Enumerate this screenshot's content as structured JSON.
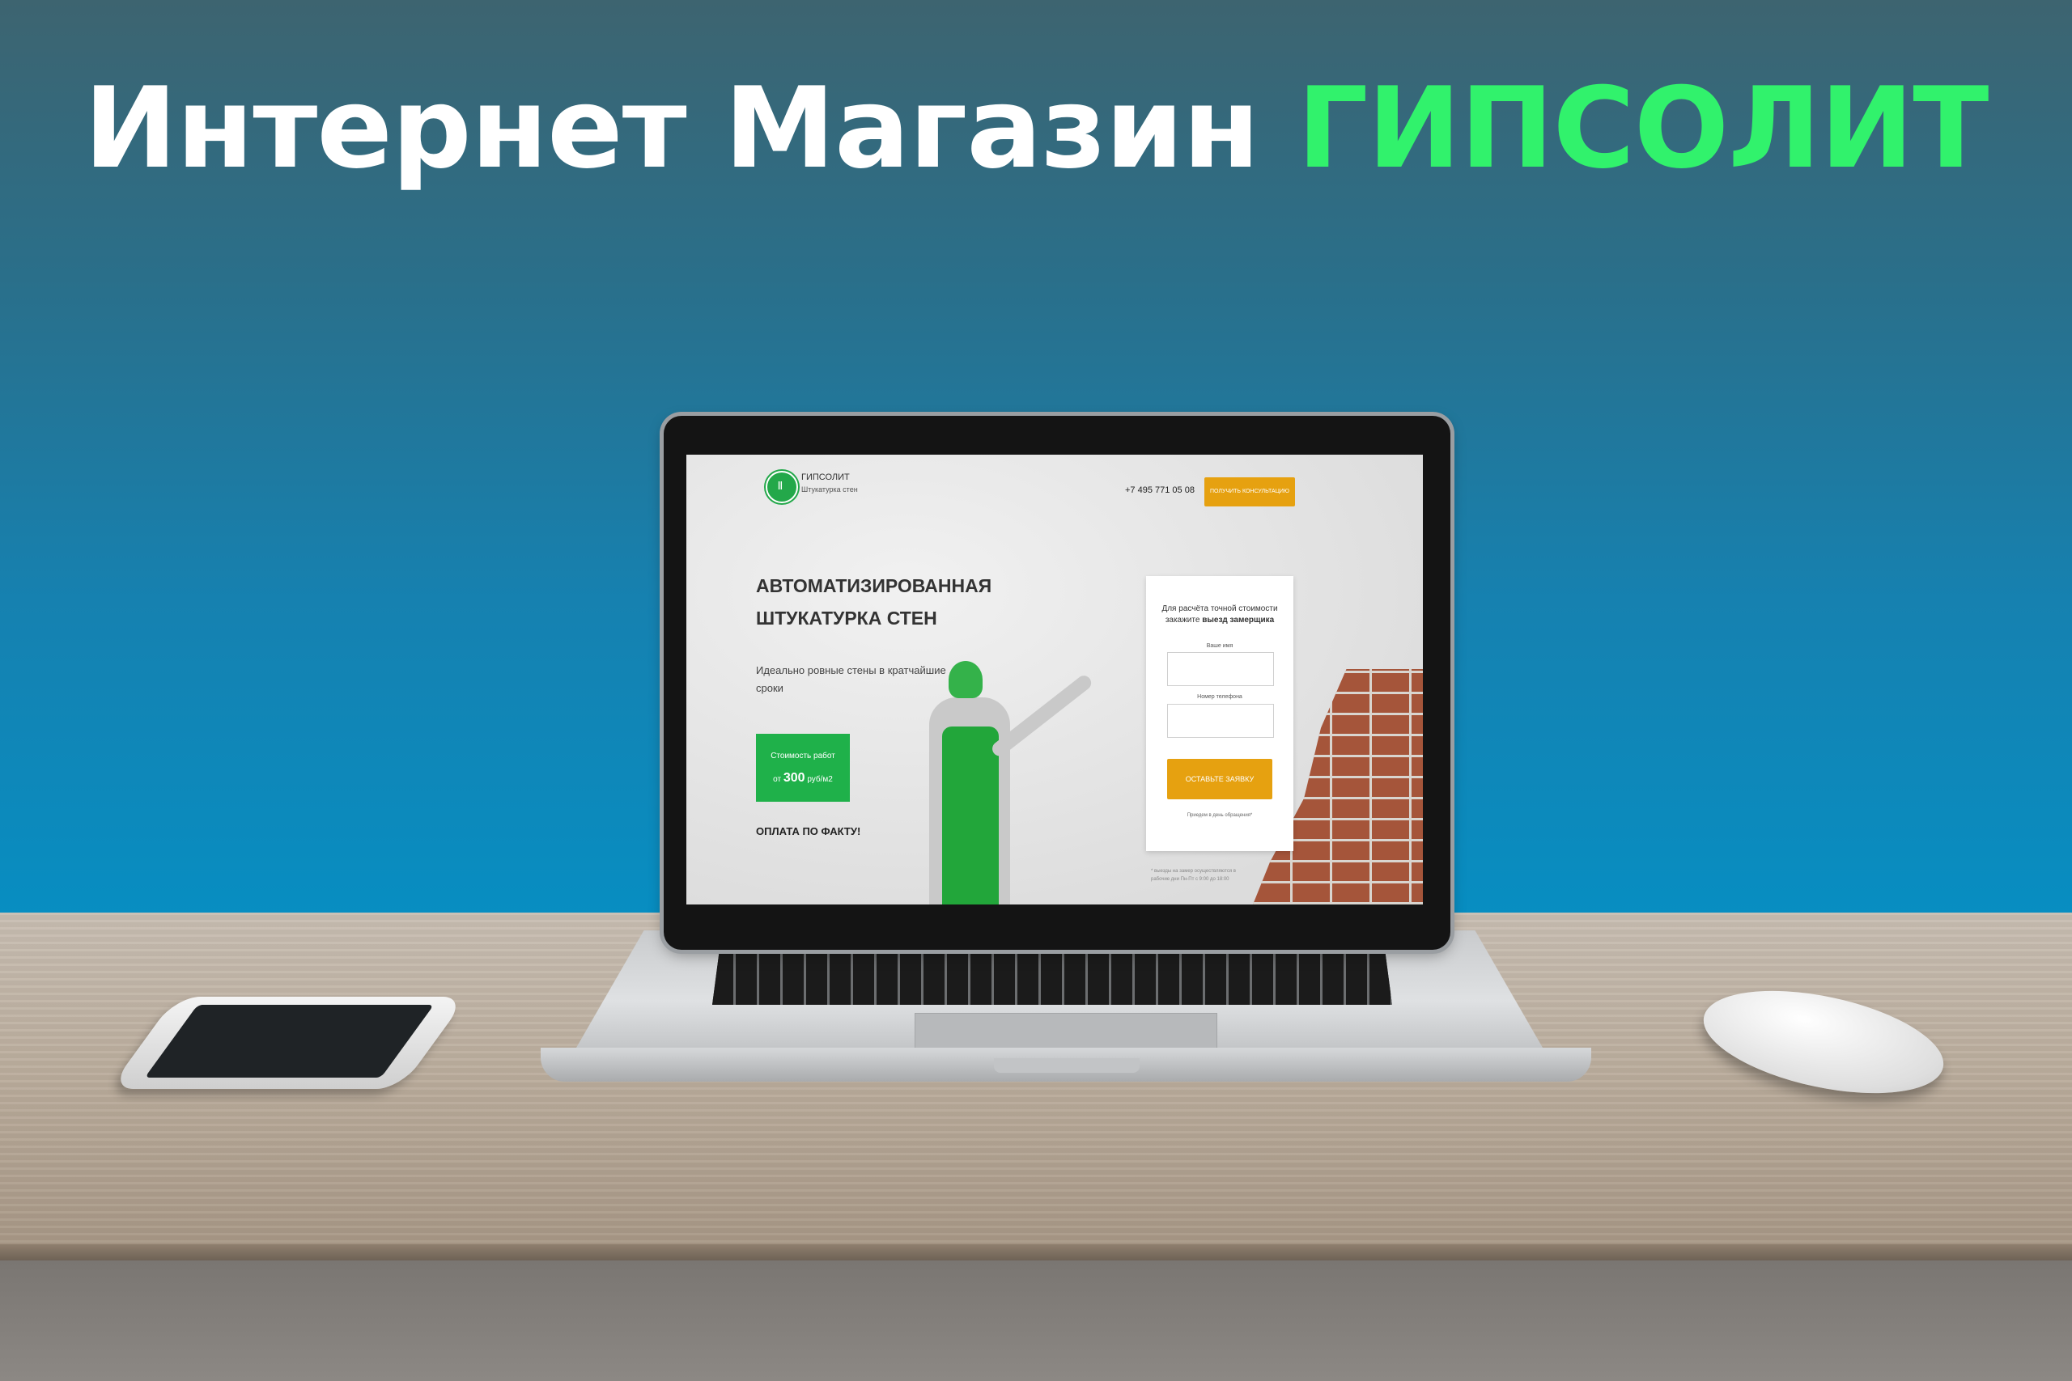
{
  "headline": {
    "part1": "Интернет Магазин",
    "brand": "ГИПСОЛИТ"
  },
  "colors": {
    "brand_green": "#31f26c",
    "site_green": "#1fb14a",
    "site_orange": "#e6a110"
  },
  "site": {
    "logo_icon": "pillar-icon",
    "name": "ГИПСОЛИТ",
    "tagline": "Штукатурка стен",
    "phone": "+7 495 771 05 08",
    "consult_button": "ПОЛУЧИТЬ КОНСУЛЬТАЦИЮ",
    "hero_title": "АВТОМАТИЗИРОВАННАЯ ШТУКАТУРКА СТЕН",
    "hero_subtitle": "Идеально ровные стены в кратчайшие сроки",
    "price_line1": "Стоимость работ",
    "price_from": "от",
    "price_value": "300",
    "price_unit": "руб/м2",
    "pay_fact": "ОПЛАТА ПО ФАКТУ!",
    "form": {
      "title": "Для расчёта точной стоимости",
      "title_prefix": "закажите",
      "title_bold": "выезд замерщика",
      "name_label": "Ваше имя",
      "name_value": "",
      "phone_label": "Номер телефона",
      "phone_value": "",
      "submit": "ОСТАВЬТЕ ЗАЯВКУ",
      "note": "Приедем в день обращения*"
    },
    "footnote": "* выезды на замер осуществляются в рабочие дни Пн-Пт с 9:00 до 18:00"
  }
}
